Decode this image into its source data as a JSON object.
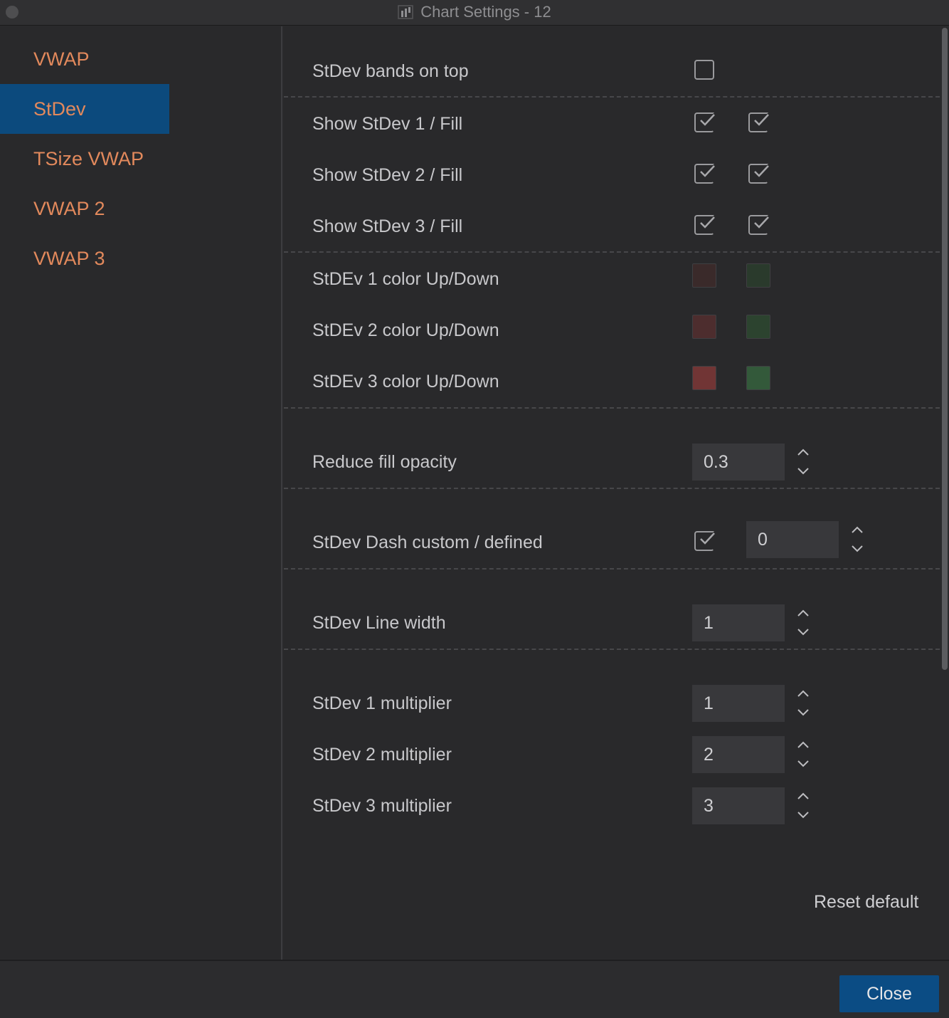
{
  "window": {
    "title": "Chart Settings - 12",
    "app_icon": "chart-bars-icon"
  },
  "sidebar": {
    "items": [
      {
        "label": "VWAP",
        "active": false
      },
      {
        "label": "StDev",
        "active": true
      },
      {
        "label": "TSize VWAP",
        "active": false
      },
      {
        "label": "VWAP 2",
        "active": false
      },
      {
        "label": "VWAP 3",
        "active": false
      }
    ]
  },
  "settings": {
    "bands_on_top": {
      "label": "StDev bands on top",
      "checked": false
    },
    "show_stdev_1": {
      "label": "Show StDev 1 / Fill",
      "show": true,
      "fill": true
    },
    "show_stdev_2": {
      "label": "Show StDev 2 / Fill",
      "show": true,
      "fill": true
    },
    "show_stdev_3": {
      "label": "Show StDev 3 / Fill",
      "show": true,
      "fill": true
    },
    "color_1": {
      "label": "StDEv 1 color Up/Down",
      "up": "#3a2a2a",
      "down": "#2a3a2c"
    },
    "color_2": {
      "label": "StDEv 2 color Up/Down",
      "up": "#4d2d2e",
      "down": "#2c432f"
    },
    "color_3": {
      "label": "StDEv 3 color Up/Down",
      "up": "#713535",
      "down": "#33593a"
    },
    "reduce_fill_opacity": {
      "label": "Reduce fill opacity",
      "value": "0.3"
    },
    "dash": {
      "label": "StDev Dash custom / defined",
      "custom": true,
      "value": "0"
    },
    "line_width": {
      "label": "StDev Line width",
      "value": "1"
    },
    "multiplier_1": {
      "label": "StDev 1 multiplier",
      "value": "1"
    },
    "multiplier_2": {
      "label": "StDev 2 multiplier",
      "value": "2"
    },
    "multiplier_3": {
      "label": "StDev 3 multiplier",
      "value": "3"
    }
  },
  "actions": {
    "reset_label": "Reset default",
    "close_label": "Close"
  }
}
